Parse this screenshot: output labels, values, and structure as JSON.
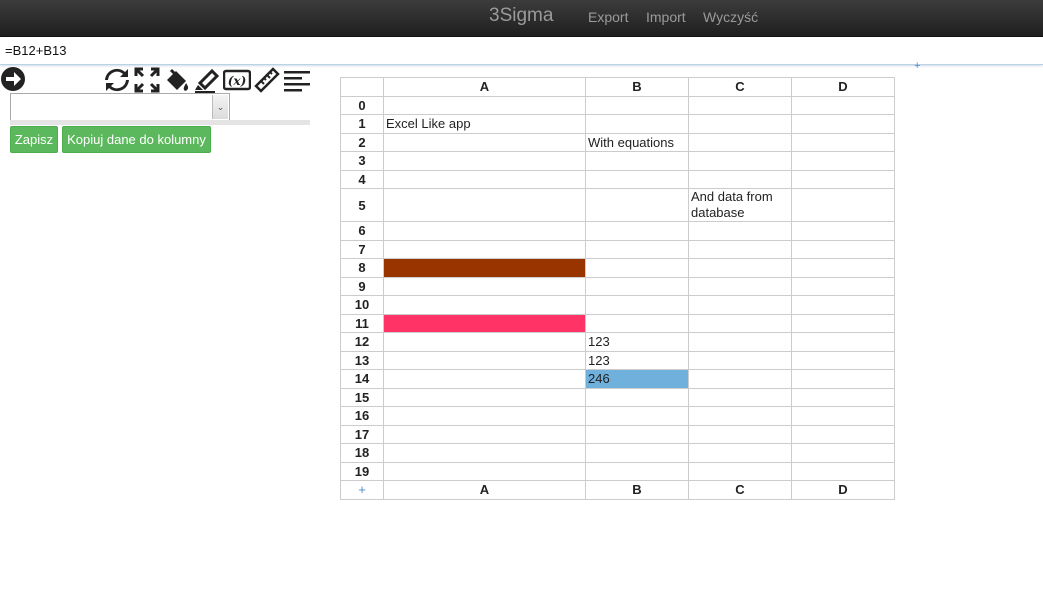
{
  "navbar": {
    "brand": "3Sigma",
    "links": [
      "Export",
      "Import",
      "Wyczyść"
    ]
  },
  "formula": {
    "value": "=B12+B13"
  },
  "corner_plus": "+",
  "toolbar": {
    "icons": [
      "arrow-right-circle-icon",
      "refresh-icon",
      "fullscreen-icon",
      "paint-bucket-icon",
      "highlighter-icon",
      "variable-icon",
      "ruler-icon",
      "align-left-icon"
    ]
  },
  "select": {
    "value": ""
  },
  "buttons": {
    "save": "Zapisz",
    "copy_to_column": "Kopiuj dane do kolumny"
  },
  "sheet": {
    "columns": [
      "A",
      "B",
      "C",
      "D"
    ],
    "footer_plus": "+",
    "rows": [
      {
        "num": "0",
        "cells": [
          "",
          "",
          "",
          ""
        ]
      },
      {
        "num": "1",
        "cells": [
          "Excel Like app",
          "",
          "",
          ""
        ]
      },
      {
        "num": "2",
        "cells": [
          "",
          "With equations",
          "",
          ""
        ]
      },
      {
        "num": "3",
        "cells": [
          "",
          "",
          "",
          ""
        ]
      },
      {
        "num": "4",
        "cells": [
          "",
          "",
          "",
          ""
        ]
      },
      {
        "num": "5",
        "cells": [
          "",
          "",
          "And data from database",
          ""
        ]
      },
      {
        "num": "6",
        "cells": [
          "",
          "",
          "",
          ""
        ]
      },
      {
        "num": "7",
        "cells": [
          "",
          "",
          "",
          ""
        ]
      },
      {
        "num": "8",
        "cells": [
          "",
          "",
          "",
          ""
        ]
      },
      {
        "num": "9",
        "cells": [
          "",
          "",
          "",
          ""
        ]
      },
      {
        "num": "10",
        "cells": [
          "",
          "",
          "",
          ""
        ]
      },
      {
        "num": "11",
        "cells": [
          "",
          "",
          "",
          ""
        ]
      },
      {
        "num": "12",
        "cells": [
          "",
          "123",
          "",
          ""
        ]
      },
      {
        "num": "13",
        "cells": [
          "",
          "123",
          "",
          ""
        ]
      },
      {
        "num": "14",
        "cells": [
          "",
          "246",
          "",
          ""
        ]
      },
      {
        "num": "15",
        "cells": [
          "",
          "",
          "",
          ""
        ]
      },
      {
        "num": "16",
        "cells": [
          "",
          "",
          "",
          ""
        ]
      },
      {
        "num": "17",
        "cells": [
          "",
          "",
          "",
          ""
        ]
      },
      {
        "num": "18",
        "cells": [
          "",
          "",
          "",
          ""
        ]
      },
      {
        "num": "19",
        "cells": [
          "",
          "",
          "",
          ""
        ]
      }
    ],
    "cell_fills": [
      {
        "row": "8",
        "col": "A",
        "color": "#993300"
      },
      {
        "row": "11",
        "col": "A",
        "color": "#ff3366"
      },
      {
        "row": "14",
        "col": "B",
        "color": "#6fb0dd"
      }
    ]
  },
  "colors": {
    "navbar": "#2b2b2b",
    "brand_text": "#9a9a9a",
    "button_green": "#5cb85c",
    "accent_blue": "#4a8ccc"
  }
}
